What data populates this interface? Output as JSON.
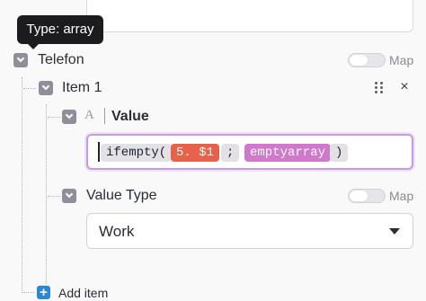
{
  "tooltip": {
    "text": "Type: array"
  },
  "telefon": {
    "label": "Telefon",
    "map_label": "Map"
  },
  "item": {
    "label": "Item 1"
  },
  "value_field": {
    "label": "Value",
    "type_icon": "A",
    "formula": {
      "tokens": [
        {
          "kind": "fn",
          "text": "ifempty("
        },
        {
          "kind": "var",
          "text": "5. $1"
        },
        {
          "kind": "fn",
          "text": ";"
        },
        {
          "kind": "kw",
          "text": "emptyarray"
        },
        {
          "kind": "fn",
          "text": ")"
        }
      ]
    }
  },
  "value_type": {
    "label": "Value Type",
    "map_label": "Map",
    "selected": "Work"
  },
  "add_item": {
    "label": "Add item"
  },
  "icons": {
    "close": "×",
    "add": "+"
  },
  "colors": {
    "accent_border": "#c79ae8",
    "var_pill": "#e8624b",
    "keyword_pill": "#d078cc",
    "add_button": "#2a86d6"
  }
}
